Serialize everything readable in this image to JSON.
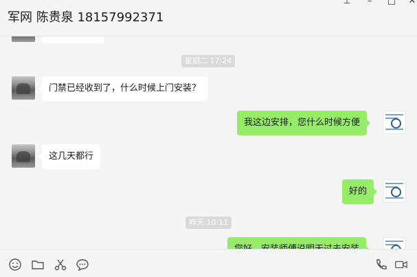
{
  "window": {
    "title": "军网 陈贵泉 18157992371",
    "pin_icon": "⊥",
    "minimize_icon": "–",
    "maximize_icon": "□",
    "close_icon": "✕"
  },
  "chat": {
    "time_labels": [
      "星期二 17:24",
      "昨天 10:11"
    ],
    "messages": [
      {
        "side": "left",
        "text": "门禁已经收到了，什么时候上门安装？"
      },
      {
        "side": "right",
        "text": "我这边安排，您什么时候方便"
      },
      {
        "side": "left",
        "text": "这几天都行"
      },
      {
        "side": "right",
        "text": "好的"
      },
      {
        "side": "right",
        "text": "您好，安装师傅说明天过去安装"
      }
    ]
  },
  "toolbar": {
    "icons": [
      "emoji-icon",
      "folder-icon",
      "scissors-icon",
      "chat-history-icon",
      "phone-icon",
      "video-icon"
    ]
  },
  "colors": {
    "sent_bubble": "#95ec69",
    "received_bubble": "#ffffff",
    "background": "#f5f5f5"
  }
}
